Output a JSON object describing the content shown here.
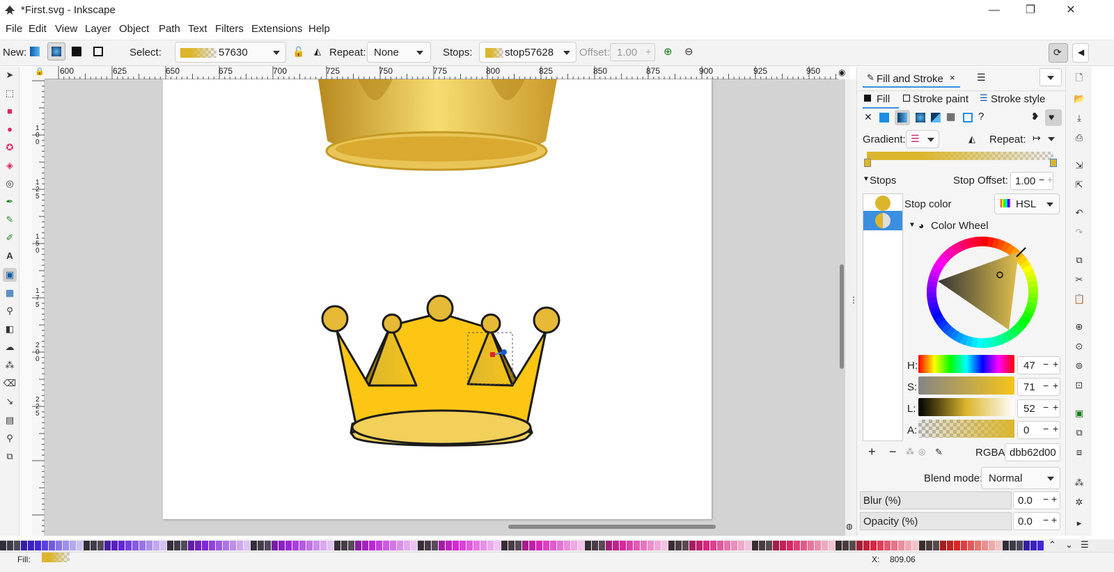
{
  "window": {
    "title": "*First.svg - Inkscape"
  },
  "menu": [
    "File",
    "Edit",
    "View",
    "Layer",
    "Object",
    "Path",
    "Text",
    "Filters",
    "Extensions",
    "Help"
  ],
  "toolbar": {
    "new_label": "New:",
    "select_label": "Select:",
    "select_value": "57630",
    "repeat_label": "Repeat:",
    "repeat_value": "None",
    "stops_label": "Stops:",
    "stops_value": "stop57628",
    "offset_label": "Offset:",
    "offset_value": "1.00"
  },
  "ruler": {
    "h_ticks": [
      "600",
      "625",
      "650",
      "675",
      "700",
      "725",
      "750",
      "775",
      "800",
      "825",
      "850",
      "875",
      "900",
      "925",
      "950"
    ],
    "v_ticks": [
      "1",
      "0",
      "0",
      "1",
      "2",
      "5",
      "1",
      "5",
      "0",
      "1",
      "7",
      "5",
      "2",
      "0",
      "0",
      "2",
      "2",
      "5"
    ]
  },
  "panel": {
    "tab_title": "Fill and Stroke",
    "subtabs": [
      "Fill",
      "Stroke paint",
      "Stroke style"
    ],
    "gradient_label": "Gradient:",
    "repeat_label": "Repeat:",
    "stops_label": "Stops",
    "stop_offset_label": "Stop Offset:",
    "stop_offset_value": "1.00",
    "stop_color_label": "Stop color",
    "color_mode": "HSL",
    "color_wheel_label": "Color Wheel",
    "h_label": "H:",
    "h_value": "47",
    "s_label": "S:",
    "s_value": "71",
    "l_label": "L:",
    "l_value": "52",
    "a_label": "A:",
    "a_value": "0",
    "rgba_label": "RGBA:",
    "rgba_value": "dbb62d00",
    "blend_label": "Blend mode:",
    "blend_value": "Normal",
    "blur_label": "Blur (%)",
    "blur_value": "0.0",
    "opacity_label": "Opacity (%)",
    "opacity_value": "0.0"
  },
  "status": {
    "fill_label": "Fill:",
    "x_label": "X:",
    "x_value": "809.06"
  },
  "colors": {
    "accent": "#dbb62d",
    "gold": "#f5c518",
    "selected_stop": "#3b8fe0"
  }
}
